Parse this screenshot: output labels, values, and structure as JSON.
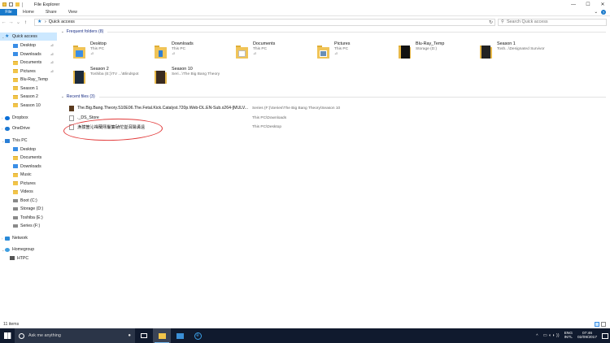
{
  "window": {
    "title": "File Explorer",
    "controls": [
      "—",
      "☐",
      "✕"
    ]
  },
  "ribbon": {
    "tabs": [
      "File",
      "Home",
      "Share",
      "View"
    ],
    "expand_glyph": "⌄",
    "help_glyph": "?"
  },
  "address_bar": {
    "back": "←",
    "forward": "→",
    "recent": "⌄",
    "up": "↑",
    "path_sep": "›",
    "path": "Quick access",
    "refresh": "↻",
    "search_placeholder": "Search Quick access"
  },
  "nav_pane": {
    "quick_access_label": "Quick access",
    "quick_access_items": [
      {
        "label": "Desktop",
        "icon": "desktop-folder-icon",
        "pinned": true
      },
      {
        "label": "Downloads",
        "icon": "downloads-folder-icon",
        "pinned": true
      },
      {
        "label": "Documents",
        "icon": "documents-folder-icon",
        "pinned": true
      },
      {
        "label": "Pictures",
        "icon": "pictures-folder-icon",
        "pinned": true
      },
      {
        "label": "Blu-Ray_Temp",
        "icon": "folder-icon",
        "pinned": false
      },
      {
        "label": "Season 1",
        "icon": "folder-icon",
        "pinned": false
      },
      {
        "label": "Season 2",
        "icon": "folder-icon",
        "pinned": false
      },
      {
        "label": "Season 10",
        "icon": "folder-icon",
        "pinned": false
      }
    ],
    "pin_glyph": "📌",
    "dropbox_label": "Dropbox",
    "onedrive_label": "OneDrive",
    "this_pc_label": "This PC",
    "this_pc_items": [
      {
        "label": "Desktop",
        "icon": "desktop-folder-icon"
      },
      {
        "label": "Documents",
        "icon": "documents-folder-icon"
      },
      {
        "label": "Downloads",
        "icon": "downloads-folder-icon"
      },
      {
        "label": "Music",
        "icon": "music-folder-icon"
      },
      {
        "label": "Pictures",
        "icon": "pictures-folder-icon"
      },
      {
        "label": "Videos",
        "icon": "videos-folder-icon"
      },
      {
        "label": "Boot (C:)",
        "icon": "drive-icon"
      },
      {
        "label": "Storage (D:)",
        "icon": "drive-icon"
      },
      {
        "label": "Toshiba (E:)",
        "icon": "drive-icon"
      },
      {
        "label": "Series (F:)",
        "icon": "drive-icon"
      }
    ],
    "network_label": "Network",
    "homegroup_label": "Homegroup",
    "htpc_label": "HTPC"
  },
  "content": {
    "frequent_header": "Frequent folders (8)",
    "frequent_folders": [
      {
        "name": "Desktop",
        "location": "This PC",
        "pinned": true
      },
      {
        "name": "Downloads",
        "location": "This PC",
        "pinned": true
      },
      {
        "name": "Documents",
        "location": "This PC",
        "pinned": true
      },
      {
        "name": "Pictures",
        "location": "This PC",
        "pinned": true
      },
      {
        "name": "Blu-Ray_Temp",
        "location": "Storage (D:)",
        "pinned": false
      },
      {
        "name": "Season 1",
        "location": "Tosh...\\Designated Survivor",
        "pinned": false
      },
      {
        "name": "Season 2",
        "location": "Toshiba (E:)\\TV ...\\Blindspot",
        "pinned": false
      },
      {
        "name": "Season 10",
        "location": "Seri...\\The Big Bang Theory",
        "pinned": false
      }
    ],
    "recent_header": "Recent files (3)",
    "recent_files": [
      {
        "name": "The.Big.Bang.Theory.S10E06.The.Fetal.Kick.Catalyst.720p.Web-DL.EN-Sub.x264-[MULV...",
        "location": "Series (F:)\\Series\\The Big Bang Theory\\Season 10"
      },
      {
        "name": "._DS_Store",
        "location": "This PC\\Downloads"
      },
      {
        "name": "漁獏箇沁禪蘭煕鬘簾碵佗豈洱陽溝遠",
        "location": "This PC\\Desktop"
      }
    ]
  },
  "status_bar": {
    "item_count": "11 items"
  },
  "taskbar": {
    "search_placeholder": "Ask me anything",
    "mic_glyph": "🎤",
    "tray_up": "^",
    "tray_sys": "▭ ◖ ◗ ))",
    "lang_top": "ENG",
    "lang_bottom": "INTL",
    "time": "07:46",
    "date": "02/09/2017"
  }
}
